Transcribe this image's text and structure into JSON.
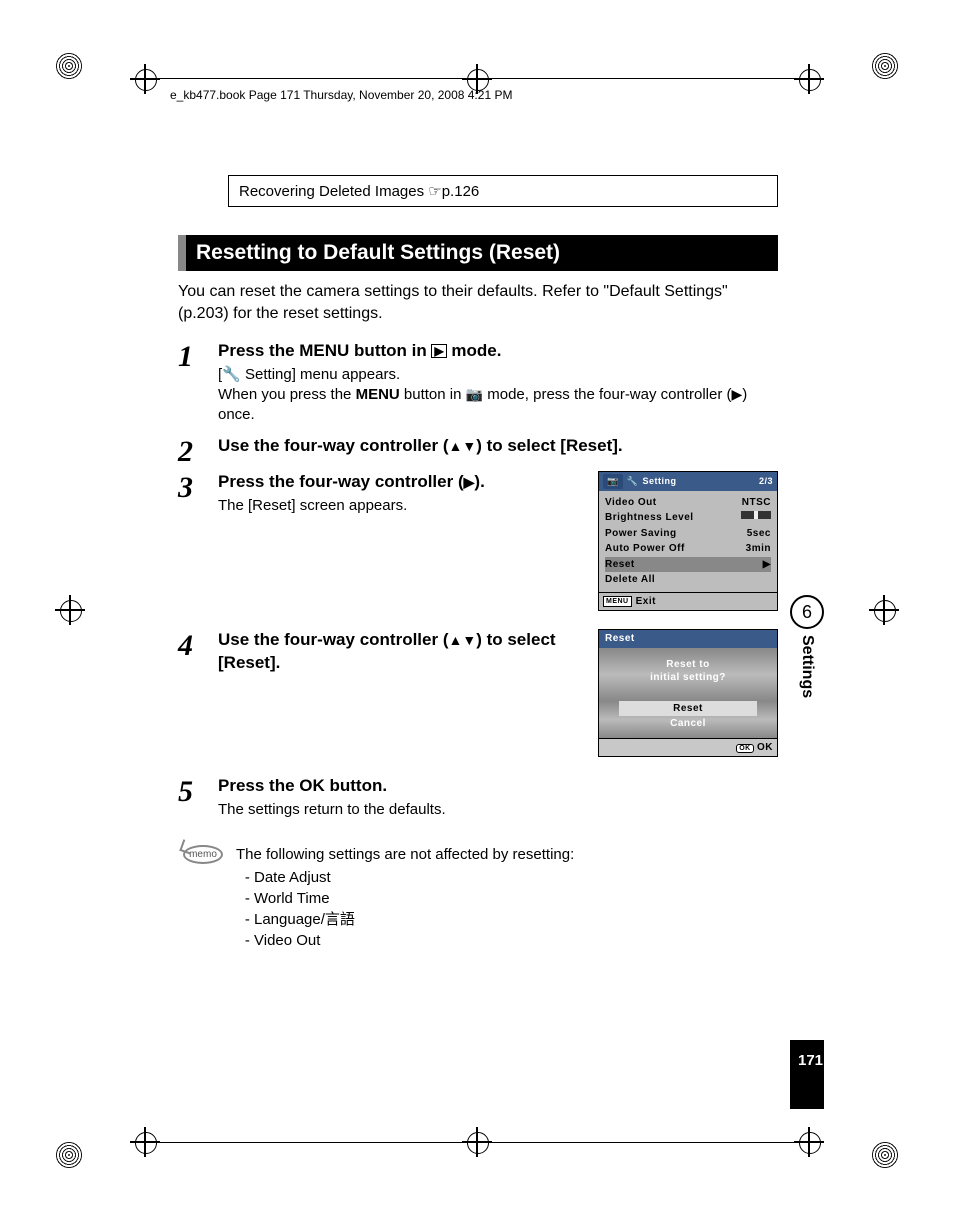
{
  "header_line": "e_kb477.book  Page 171  Thursday, November 20, 2008  4:21 PM",
  "ref_box": "Recovering Deleted Images ☞p.126",
  "section_title": "Resetting to Default Settings (Reset)",
  "intro": "You can reset the camera settings to their defaults. Refer to \"Default Settings\" (p.203) for the reset settings.",
  "steps": {
    "s1": {
      "num": "1",
      "title_a": "Press the ",
      "title_menu": "MENU",
      "title_b": " button in ",
      "title_c": " mode.",
      "desc1_a": "[",
      "desc1_b": " Setting] menu appears.",
      "desc2_a": "When you press the ",
      "desc2_menu": "MENU",
      "desc2_b": " button in ",
      "desc2_c": " mode, press the four-way controller (",
      "desc2_tri": "▶",
      "desc2_d": ") once."
    },
    "s2": {
      "num": "2",
      "title_a": "Use the four-way controller (",
      "title_tri": "▲▼",
      "title_b": ") to select [Reset]."
    },
    "s3": {
      "num": "3",
      "title_a": "Press the four-way controller (",
      "title_tri": "▶",
      "title_b": ").",
      "desc": "The [Reset] screen appears."
    },
    "s4": {
      "num": "4",
      "title_a": "Use the four-way controller (",
      "title_tri": "▲▼",
      "title_b": ") to select [Reset]."
    },
    "s5": {
      "num": "5",
      "title_a": "Press the ",
      "title_ok": "OK",
      "title_b": " button.",
      "desc": "The settings return to the defaults."
    }
  },
  "lcd1": {
    "tab_label": "Setting",
    "page": "2/3",
    "rows": [
      {
        "label": "Video Out",
        "value": "NTSC"
      },
      {
        "label": "Brightness Level",
        "value": ""
      },
      {
        "label": "Power Saving",
        "value": "5sec"
      },
      {
        "label": "Auto Power Off",
        "value": "3min"
      },
      {
        "label": "Reset",
        "value": "▶"
      },
      {
        "label": "Delete All",
        "value": ""
      }
    ],
    "footer_badge": "MENU",
    "footer_label": "Exit"
  },
  "lcd2": {
    "title": "Reset",
    "msg1": "Reset to",
    "msg2": "initial setting?",
    "opt_reset": "Reset",
    "opt_cancel": "Cancel",
    "footer_badge": "OK",
    "footer_label": "OK"
  },
  "memo": {
    "icon_label": "memo",
    "intro": "The following settings are not affected by resetting:",
    "items": [
      "Date Adjust",
      "World Time",
      "Language/言語",
      "Video Out"
    ]
  },
  "side": {
    "chapter": "6",
    "label": "Settings"
  },
  "page_number": "171"
}
